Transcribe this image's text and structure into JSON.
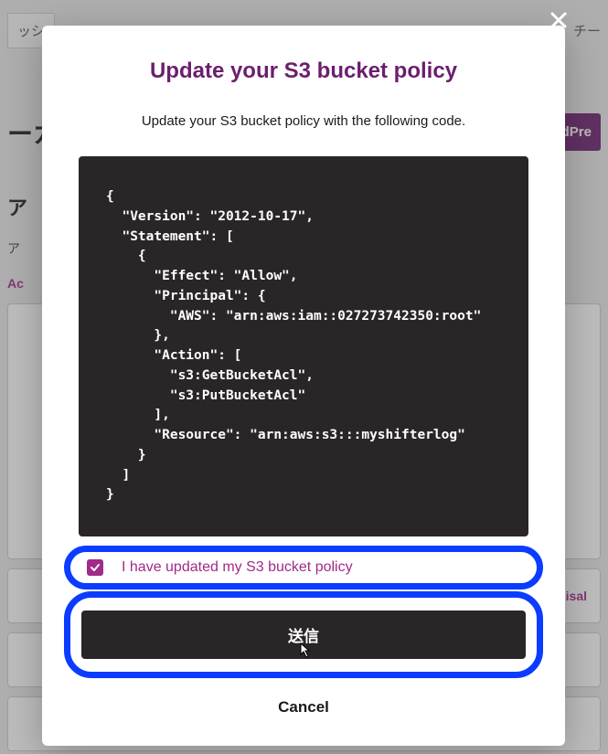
{
  "background": {
    "tab_left": "ッシ",
    "tab_right": "チー",
    "heading_partial": "ーカ",
    "purple_btn_partial": "ordPre",
    "section_title": "ア",
    "section_sub": "ア",
    "section_tab": "Ac",
    "row_disable": "Disal"
  },
  "modal": {
    "title": "Update your S3 bucket policy",
    "description": "Update your S3 bucket policy with the following code.",
    "code": "{\n  \"Version\": \"2012-10-17\",\n  \"Statement\": [\n    {\n      \"Effect\": \"Allow\",\n      \"Principal\": {\n        \"AWS\": \"arn:aws:iam::027273742350:root\"\n      },\n      \"Action\": [\n        \"s3:GetBucketAcl\",\n        \"s3:PutBucketAcl\"\n      ],\n      \"Resource\": \"arn:aws:s3:::myshifterlog\"\n    }\n  ]\n}",
    "checkbox_label": "I have updated my S3 bucket policy",
    "submit_label": "送信",
    "cancel_label": "Cancel"
  }
}
